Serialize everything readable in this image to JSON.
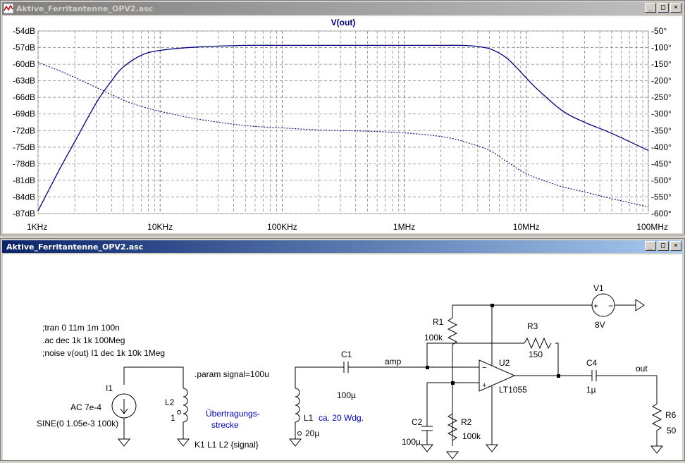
{
  "plot_window": {
    "title": "Aktive_Ferritantenne_OPV2.asc",
    "trace_label": "V(out)",
    "minimize_symbol": "_",
    "restore_symbol": "□",
    "close_symbol": "×",
    "line_color": "#000080"
  },
  "chart_data": {
    "type": "line",
    "title": "V(out)",
    "x_scale": "log",
    "x_range_hz": [
      1000,
      100000000
    ],
    "x_tick_labels": [
      "1KHz",
      "10KHz",
      "100KHz",
      "1MHz",
      "10MHz",
      "100MHz"
    ],
    "y_left_range_db": [
      -87,
      -54
    ],
    "y_left_tick_labels": [
      "-54dB",
      "-57dB",
      "-60dB",
      "-63dB",
      "-66dB",
      "-69dB",
      "-72dB",
      "-75dB",
      "-78dB",
      "-81dB",
      "-84dB",
      "-87dB"
    ],
    "y_right_range_deg": [
      -600,
      -50
    ],
    "y_right_tick_labels": [
      "-50°",
      "-100°",
      "-150°",
      "-200°",
      "-250°",
      "-300°",
      "-350°",
      "-400°",
      "-450°",
      "-500°",
      "-550°",
      "-600°"
    ],
    "grid": true,
    "series": [
      {
        "style": "solid",
        "axis": "left",
        "x": [
          1000,
          1500,
          2000,
          3000,
          4000,
          5000,
          7000,
          10000,
          20000,
          50000,
          100000,
          300000,
          1000000,
          2000000,
          3000000,
          4000000,
          5000000,
          6000000,
          7000000,
          8000000,
          10000000,
          13000000,
          20000000,
          30000000,
          50000000,
          100000000
        ],
        "y": [
          -86.5,
          -79,
          -74,
          -67,
          -63,
          -60.5,
          -58.4,
          -57.5,
          -56.9,
          -56.6,
          -56.6,
          -56.6,
          -56.6,
          -56.6,
          -56.6,
          -56.8,
          -57.2,
          -58.0,
          -59.0,
          -60.2,
          -62.5,
          -65.0,
          -68.5,
          -70.5,
          -72.5,
          -75.6
        ]
      },
      {
        "style": "dotted",
        "axis": "right",
        "x": [
          1000,
          1500,
          2000,
          3000,
          5000,
          7000,
          10000,
          20000,
          50000,
          100000,
          200000,
          500000,
          1000000,
          2000000,
          3000000,
          5000000,
          7000000,
          10000000,
          15000000,
          20000000,
          30000000,
          50000000,
          100000000
        ],
        "y": [
          -145,
          -170,
          -190,
          -220,
          -258,
          -277,
          -292,
          -315,
          -335,
          -342,
          -348,
          -352,
          -357,
          -368,
          -382,
          -410,
          -445,
          -480,
          -505,
          -520,
          -535,
          -555,
          -580
        ]
      }
    ]
  },
  "schematic_window": {
    "title": "Aktive_Ferritantenne_OPV2.asc",
    "minimize_symbol": "_",
    "restore_symbol": "□",
    "close_symbol": "×",
    "directive_tran": ";tran 0 11m 1m 100n",
    "directive_ac": ".ac dec 1k 1k 100Meg",
    "directive_noise": ";noise v(out) I1 dec 1k 10k 1Meg",
    "directive_param": ".param signal=100u",
    "directive_coupling": "K1 L1 L2 {signal}",
    "comment_line1": "Übertragungs-",
    "comment_line2": "strecke",
    "comment_turns": "ca. 20 Wdg.",
    "i1_name": "I1",
    "i1_ac": "AC 7e-4",
    "i1_sine": "SINE(0 1.05e-3 100k)",
    "l2_name": "L2",
    "l2_value": "1",
    "l1_name": "L1",
    "l1_value": "20µ",
    "c1_name": "C1",
    "c1_value": "100µ",
    "net_amp": "amp",
    "r1_name": "R1",
    "r1_value": "100k",
    "r2_name": "R2",
    "r2_value": "100k",
    "c2_name": "C2",
    "c2_value": "100µ",
    "r3_name": "R3",
    "r3_value": "150",
    "u2_name": "U2",
    "u2_model": "LT1055",
    "c4_name": "C4",
    "c4_value": "1µ",
    "net_out": "out",
    "r6_name": "R6",
    "r6_value": "50",
    "v1_name": "V1",
    "v1_value": "8V",
    "opamp_minus": "−",
    "opamp_plus": "+",
    "src_plus": "+",
    "src_minus": "−"
  }
}
